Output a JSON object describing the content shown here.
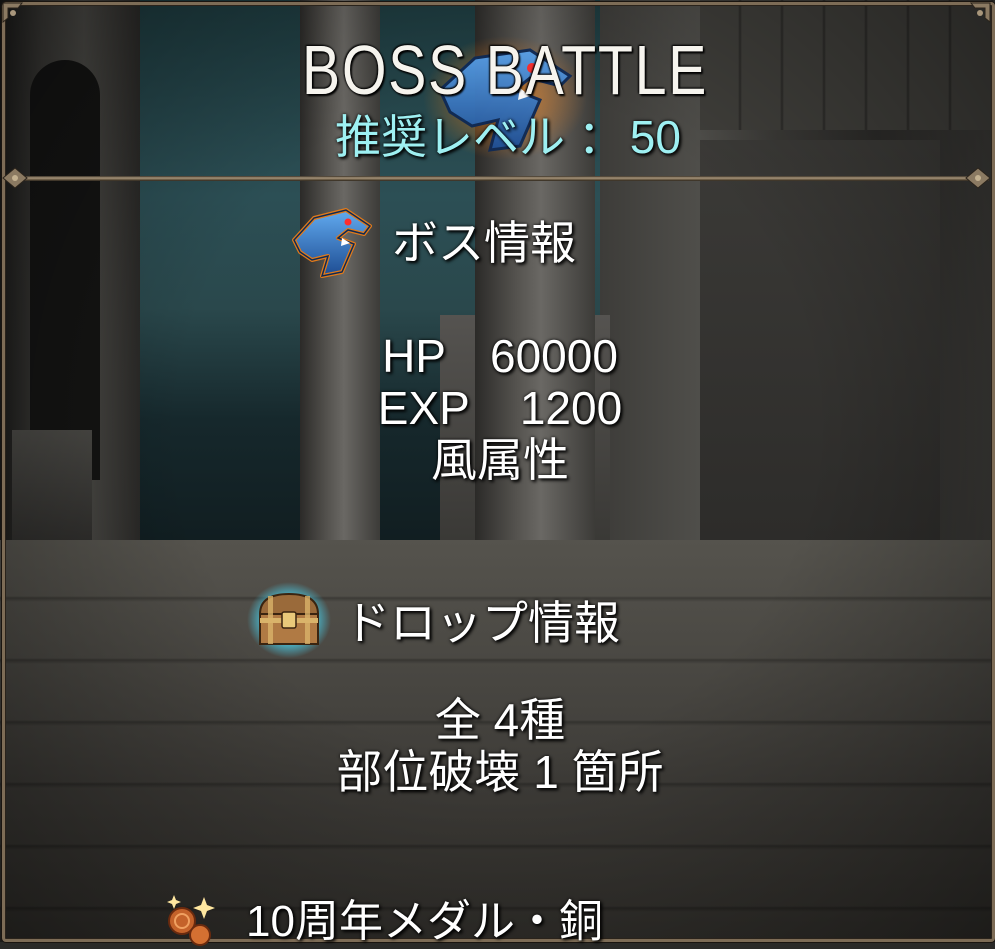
{
  "header": {
    "title": "BOSS BATTLE",
    "level_label": "推奨レベル ：",
    "level_value": "50"
  },
  "boss_info": {
    "heading": "ボス情報",
    "icon": "boss-shark-emblem-icon",
    "hp_label": "HP",
    "hp_value": "60000",
    "exp_label": "EXP",
    "exp_value": "1200",
    "element": "風属性"
  },
  "drop_info": {
    "heading": "ドロップ情報",
    "icon": "treasure-chest-icon",
    "kinds": "全 4種",
    "part_break": "部位破壊 1 箇所"
  },
  "drop_items": [
    {
      "icon": "copper-medal-icon",
      "label": "10周年メダル・銅"
    }
  ],
  "colors": {
    "title": "#f6f4ee",
    "level": "#9ef0f2",
    "frame": "#7d6c56",
    "emblem_blue": "#3b7fd0",
    "emblem_glow": "#e07a1a"
  }
}
